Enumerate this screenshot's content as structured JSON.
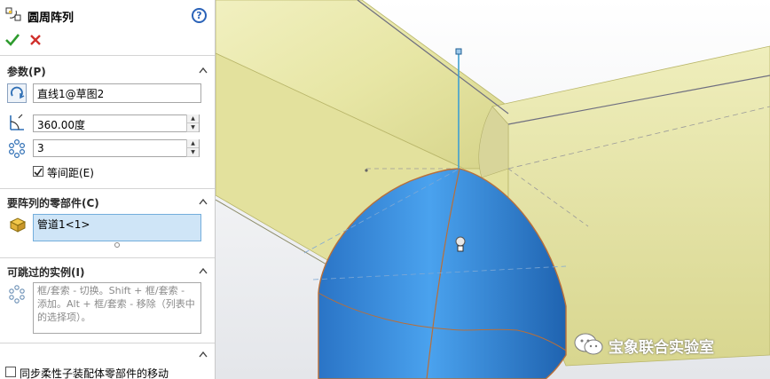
{
  "feature": {
    "title": "圆周阵列",
    "help_glyph": "?",
    "ok": "confirm-check-icon",
    "cancel": "cancel-x-icon"
  },
  "params": {
    "header": "参数(P)",
    "axis_value": "直线1@草图2",
    "angle_value": "360.00度",
    "count_value": "3",
    "equal_spacing_label": "等间距(E)",
    "equal_spacing_checked": true
  },
  "components": {
    "header": "要阵列的零部件(C)",
    "selected": "管道1<1>"
  },
  "skip": {
    "header": "可跳过的实例(I)",
    "hint": "框/套索 - 切换。Shift + 框/套索 - 添加。Alt + 框/套索 - 移除（列表中的选择项）。"
  },
  "options": {
    "sync_label": "同步柔性子装配体零部件的移动"
  },
  "watermark": {
    "text": "宝象联合实验室"
  },
  "colors": {
    "yellow_pipe": "#e8e7a4",
    "blue_pipe": "#3a8fe0",
    "selection_fill": "#cfe5f7",
    "accent_green": "#2e9b2e",
    "accent_red": "#d0312d"
  }
}
